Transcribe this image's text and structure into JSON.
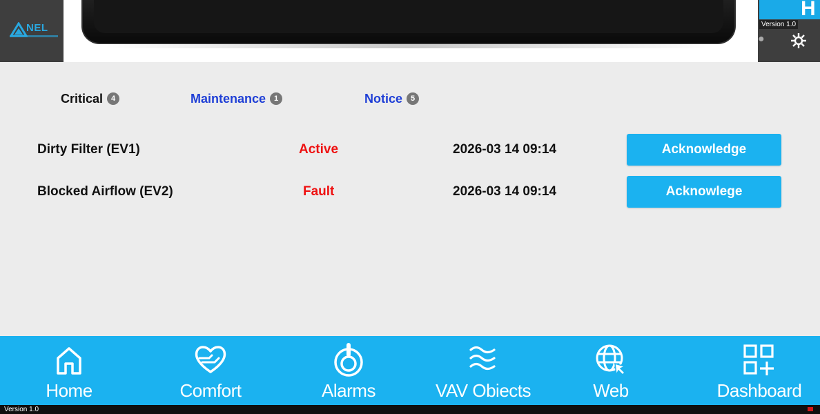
{
  "header": {
    "logo_text": "NEL",
    "title_fragment": "H",
    "version": "Version 1.0"
  },
  "tabs": [
    {
      "label": "Critical",
      "count": "4"
    },
    {
      "label": "Maintenance",
      "count": "1"
    },
    {
      "label": "Notice",
      "count": "5"
    }
  ],
  "alarms": [
    {
      "name": "Dirty Filter (EV1)",
      "status": "Active",
      "timestamp": "2026-03 14 09:14",
      "button": "Acknowledge"
    },
    {
      "name": "Blocked Airflow (EV2)",
      "status": "Fault",
      "timestamp": "2026-03 14 09:14",
      "button": "Acknowlege"
    }
  ],
  "nav": [
    {
      "label": "Home",
      "icon": "home-icon"
    },
    {
      "label": "Comfort",
      "icon": "comfort-heart-icon"
    },
    {
      "label": "Alarms",
      "icon": "alarm-icon"
    },
    {
      "label": "VAV Obiects",
      "icon": "airflow-waves-icon"
    },
    {
      "label": "Web",
      "icon": "globe-cursor-icon"
    },
    {
      "label": "Dashboard",
      "icon": "dashboard-grid-icon"
    }
  ],
  "footer": {
    "version": "Version 1.0"
  },
  "colors": {
    "accent": "#1bb2f0",
    "status_error": "#ee1111",
    "tab_link": "#1f3fd6",
    "header_bg": "#3e3e3e"
  }
}
